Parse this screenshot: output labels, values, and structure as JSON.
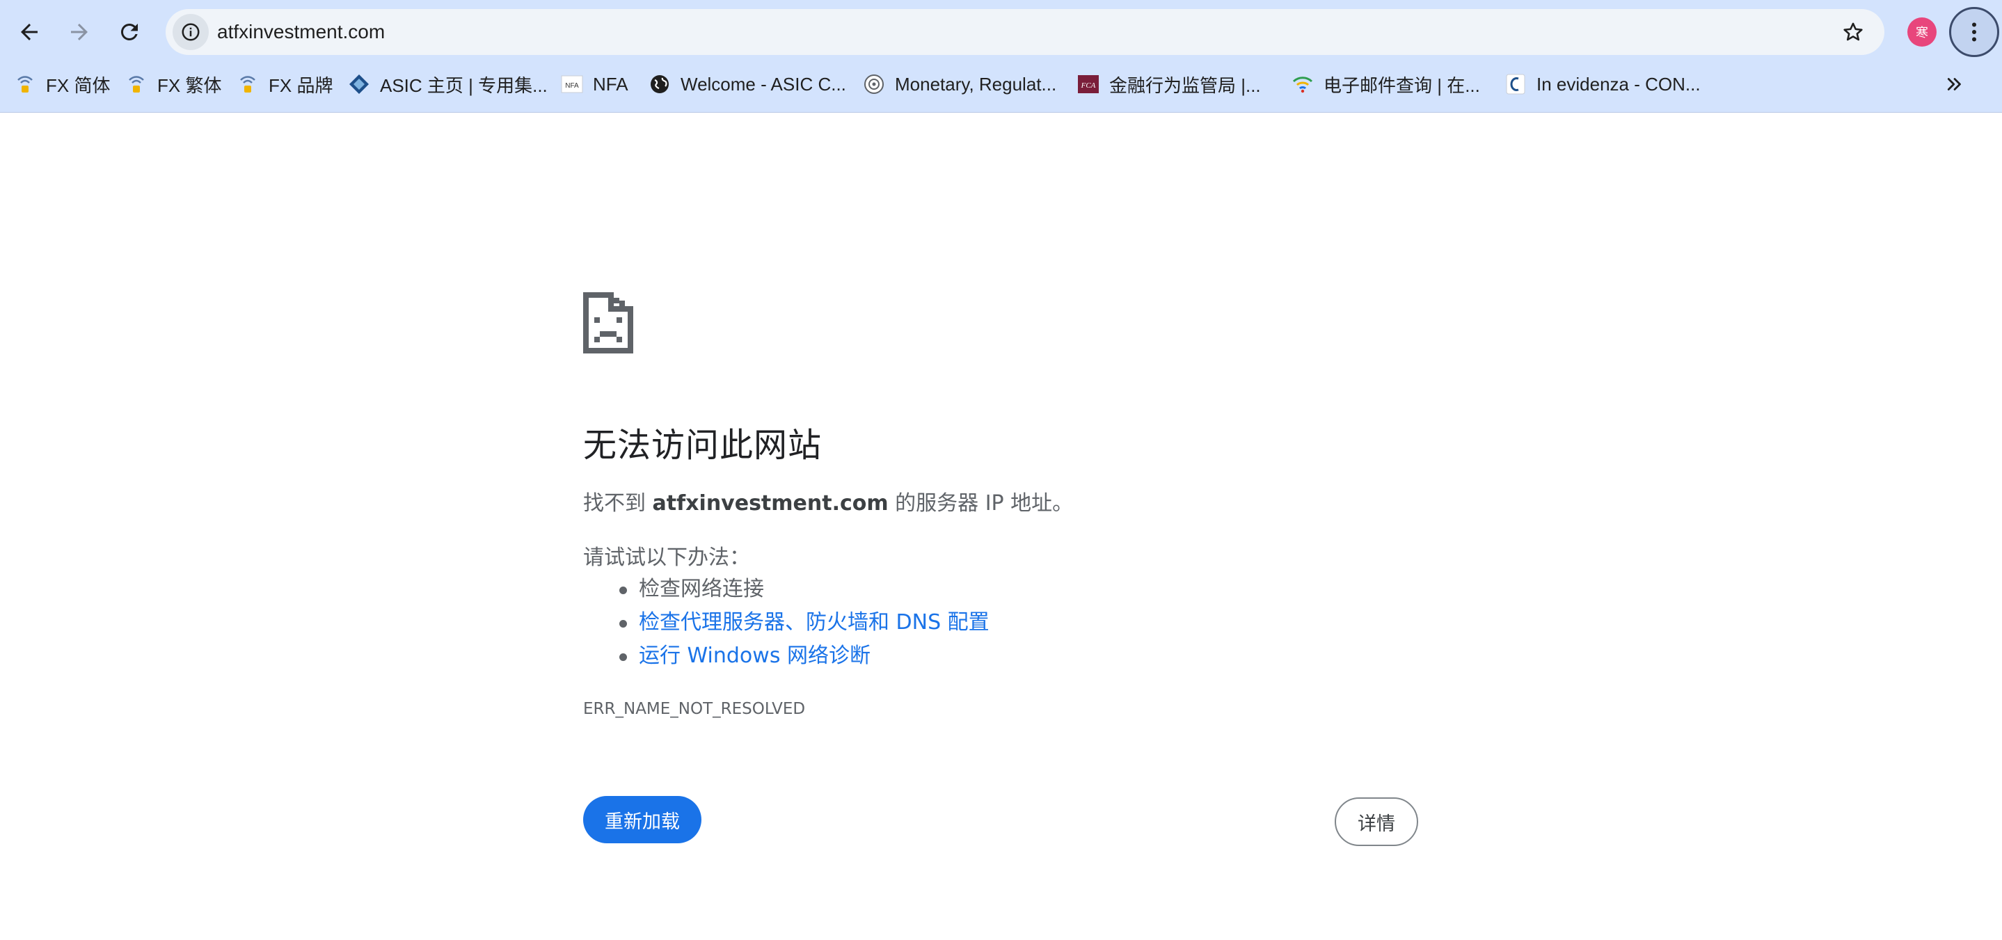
{
  "browser": {
    "address_bar": {
      "url": "atfxinvestment.com"
    },
    "profile_avatar_text": "寒",
    "colors": {
      "toolbar_bg": "#d3e3fd",
      "omnibox_bg": "#f0f4f9",
      "avatar": "#e8467c"
    },
    "bookmarks": [
      {
        "label": "FX 简体",
        "icon": "fx-favicon"
      },
      {
        "label": "FX 繁体",
        "icon": "fx-favicon"
      },
      {
        "label": "FX 品牌",
        "icon": "fx-favicon"
      },
      {
        "label": "ASIC 主页 | 专用集...",
        "icon": "asic-favicon"
      },
      {
        "label": "NFA",
        "icon": "nfa-favicon"
      },
      {
        "label": "Welcome - ASIC C...",
        "icon": "globe-favicon"
      },
      {
        "label": "Monetary, Regulat...",
        "icon": "mas-favicon"
      },
      {
        "label": "金融行为监管局 |...",
        "icon": "fca-favicon"
      },
      {
        "label": "电子邮件查询 | 在...",
        "icon": "wifi-favicon"
      },
      {
        "label": "In evidenza - CON...",
        "icon": "consob-favicon"
      }
    ]
  },
  "error_page": {
    "title": "无法访问此网站",
    "summary_prefix": "找不到 ",
    "summary_host": "atfxinvestment.com",
    "summary_suffix": " 的服务器 IP 地址。",
    "suggestions_heading": "请试试以下办法：",
    "suggestions": [
      "检查网络连接",
      "检查代理服务器、防火墙和 DNS 配置",
      "运行 Windows 网络诊断"
    ],
    "error_code": "ERR_NAME_NOT_RESOLVED",
    "reload_label": "重新加载",
    "details_label": "详情",
    "colors": {
      "primary_button": "#1a73e8",
      "link": "#1a73e8",
      "body_text": "#5f6368"
    }
  }
}
